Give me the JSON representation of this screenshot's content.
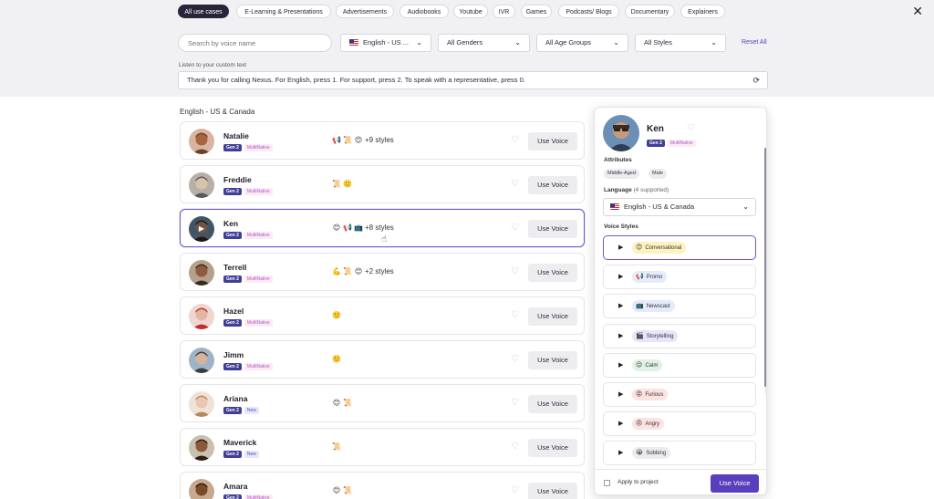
{
  "categories": [
    {
      "label": "All use cases",
      "active": true
    },
    {
      "label": "E-Learning & Presentations"
    },
    {
      "label": "Advertisements"
    },
    {
      "label": "Audiobooks"
    },
    {
      "label": "Youtube"
    },
    {
      "label": "IVR"
    },
    {
      "label": "Games"
    },
    {
      "label": "Podcasts/ Blogs"
    },
    {
      "label": "Documentary"
    },
    {
      "label": "Explainers"
    }
  ],
  "close_glyph": "✕",
  "filters": {
    "search_placeholder": "Search by voice name",
    "language": "English - US ...",
    "gender": "All Genders",
    "age": "All Age Groups",
    "style": "All Styles",
    "reset": "Reset All"
  },
  "custom_text": {
    "label": "Listen to your custom text",
    "value": "Thank you for calling Nexus. For English, press 1. For support, press 2. To speak with a representative, press 0."
  },
  "section_title": "English - US & Canada",
  "row_labels": {
    "gen": "Gen 2",
    "multi": "MultiNative",
    "new": "New",
    "use": "Use Voice"
  },
  "voices": [
    {
      "name": "Natalie",
      "tags": [
        "gen",
        "multi"
      ],
      "icons": [
        "📢",
        "📜",
        "😊"
      ],
      "extra": "+9 styles"
    },
    {
      "name": "Freddie",
      "tags": [
        "gen",
        "multi"
      ],
      "icons": [
        "📜",
        "🙂"
      ],
      "extra": ""
    },
    {
      "name": "Ken",
      "tags": [
        "gen",
        "multi"
      ],
      "icons": [
        "😊",
        "📢",
        "📺"
      ],
      "extra": "+8 styles",
      "selected": true
    },
    {
      "name": "Terrell",
      "tags": [
        "gen",
        "multi"
      ],
      "icons": [
        "💪",
        "📜",
        "😊"
      ],
      "extra": "+2 styles"
    },
    {
      "name": "Hazel",
      "tags": [
        "gen",
        "multi"
      ],
      "icons": [
        "🙂"
      ],
      "extra": ""
    },
    {
      "name": "Jimm",
      "tags": [
        "gen",
        "multi"
      ],
      "icons": [
        "🙂"
      ],
      "extra": ""
    },
    {
      "name": "Ariana",
      "tags": [
        "gen",
        "new"
      ],
      "icons": [
        "😊",
        "📜"
      ],
      "extra": ""
    },
    {
      "name": "Maverick",
      "tags": [
        "gen",
        "new"
      ],
      "icons": [
        "📜"
      ],
      "extra": ""
    },
    {
      "name": "Amara",
      "tags": [
        "gen",
        "multi"
      ],
      "icons": [
        "😊",
        "📜"
      ],
      "extra": ""
    }
  ],
  "panel": {
    "name": "Ken",
    "attributes_label": "Attributes",
    "attributes": [
      "Middle-Aged",
      "Male"
    ],
    "language_label": "Language",
    "language_sub": "(4 supported)",
    "language": "English - US & Canada",
    "styles_label": "Voice Styles",
    "styles": [
      {
        "label": "Conversational",
        "icon": "😊",
        "color": "#fdf1bf",
        "active": true
      },
      {
        "label": "Promo",
        "icon": "📢",
        "color": "#e4ecfb"
      },
      {
        "label": "Newscast",
        "icon": "📺",
        "color": "#e4ecfb"
      },
      {
        "label": "Storytelling",
        "icon": "🎬",
        "color": "#e9e4fb"
      },
      {
        "label": "Calm",
        "icon": "😌",
        "color": "#dff3e4"
      },
      {
        "label": "Furious",
        "icon": "😡",
        "color": "#fde2e2"
      },
      {
        "label": "Angry",
        "icon": "😠",
        "color": "#fde2e2"
      },
      {
        "label": "Sobbing",
        "icon": "😭",
        "color": "#ececf0"
      }
    ],
    "apply_label": "Apply to project",
    "use_label": "Use Voice"
  }
}
